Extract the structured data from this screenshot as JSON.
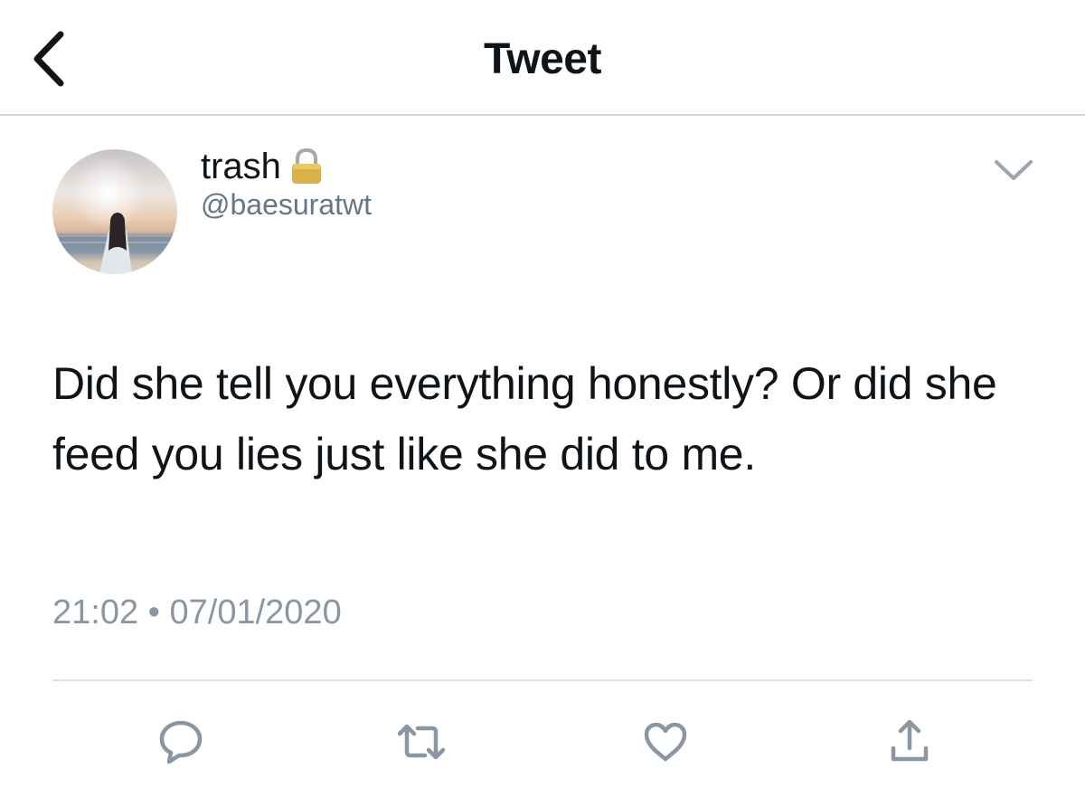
{
  "header": {
    "title": "Tweet",
    "back_icon": "chevron-left-icon"
  },
  "author": {
    "display_name": "trash",
    "lock_icon": "lock-icon",
    "handle": "@baesuratwt"
  },
  "tweet": {
    "text": "Did she tell you everything honestly? Or did she feed you lies just like she did to me.",
    "time": "21:02 • 07/01/2020"
  },
  "actions": {
    "reply_icon": "reply-icon",
    "retweet_icon": "retweet-icon",
    "like_icon": "heart-icon",
    "share_icon": "share-icon"
  },
  "colors": {
    "text": "#0f1419",
    "secondary": "#657786",
    "icon": "#8a96a1",
    "divider": "#dfe3e6"
  }
}
